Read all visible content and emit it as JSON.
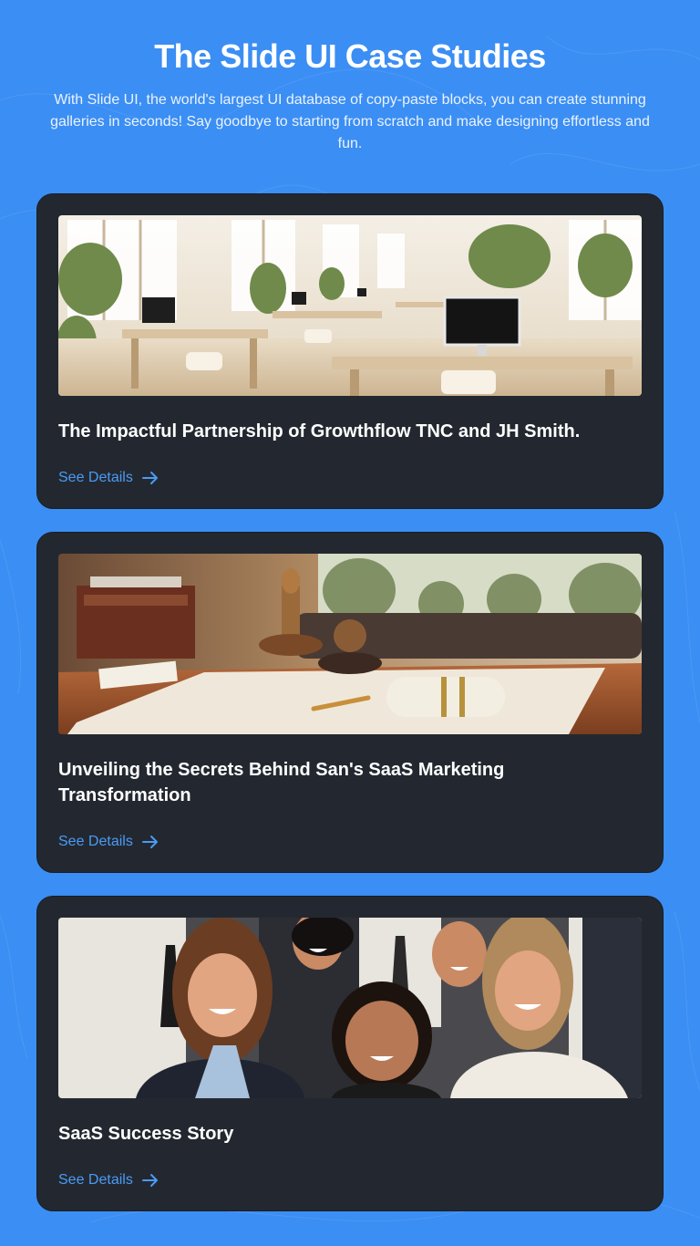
{
  "header": {
    "title": "The Slide UI Case Studies",
    "subtitle": "With Slide UI, the world's largest UI database of copy-paste blocks, you can create stunning galleries in seconds! Say goodbye to starting from scratch and make designing effortless and fun."
  },
  "cards": [
    {
      "title": "The Impactful Partnership of Growthflow TNC and JH Smith.",
      "link": "See Details",
      "image": "office-workspace-photo"
    },
    {
      "title": "Unveiling the Secrets Behind San's SaaS Marketing Transformation",
      "link": "See Details",
      "image": "desk-documents-photo"
    },
    {
      "title": "SaaS Success Story",
      "link": "See Details",
      "image": "team-group-photo"
    }
  ],
  "icons": {
    "link_arrow": "arrow-right-icon"
  },
  "colors": {
    "background": "#3b8ef3",
    "card": "#232830",
    "link": "#4a9bf5"
  }
}
